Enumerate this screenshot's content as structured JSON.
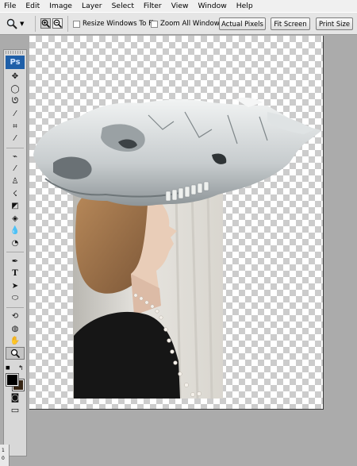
{
  "menubar": {
    "items": [
      "File",
      "Edit",
      "Image",
      "Layer",
      "Select",
      "Filter",
      "View",
      "Window",
      "Help"
    ]
  },
  "options": {
    "resize_windows_label": "Resize Windows To Fit",
    "zoom_all_windows_label": "Zoom All Windows",
    "actual_pixels_label": "Actual Pixels",
    "fit_screen_label": "Fit Screen",
    "print_size_label": "Print Size"
  },
  "toolbox": {
    "logo": "Ps",
    "active_tool": "zoom-tool",
    "foreground_color": "#000000",
    "background_color": "#352413"
  },
  "ruler": {
    "marks": [
      "1",
      "0"
    ]
  },
  "canvas": {
    "background": "transparent-checkerboard",
    "artwork": "animal skull collage over portrait of woman in profile"
  }
}
